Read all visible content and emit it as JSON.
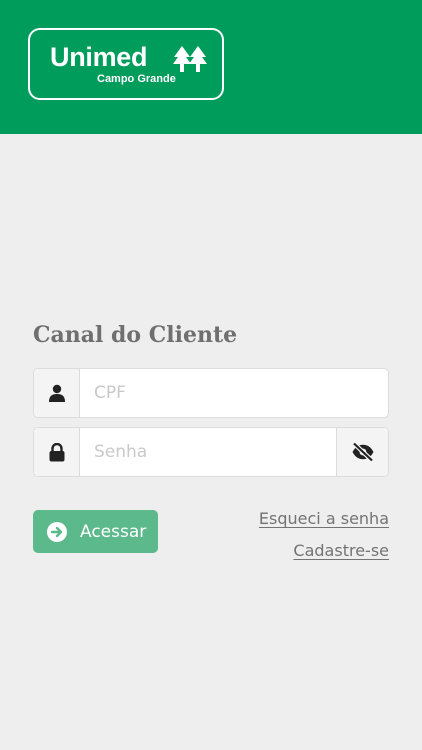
{
  "header": {
    "brand": "Unimed",
    "brand_sub": "Campo Grande",
    "bg_color": "#009c5b",
    "icons": {
      "logo": "unimed-pine-trees-icon"
    }
  },
  "form": {
    "title": "Canal do Cliente",
    "cpf": {
      "placeholder": "CPF",
      "value": "",
      "icon": "user-icon"
    },
    "password": {
      "placeholder": "Senha",
      "value": "",
      "icon": "lock-icon",
      "toggle_icon": "eye-slash-icon"
    },
    "submit": {
      "label": "Acessar",
      "icon": "arrow-circle-right-icon",
      "color": "#5cb98c"
    },
    "forgot_link": "Esqueci a senha",
    "signup_link": "Cadastre-se"
  }
}
